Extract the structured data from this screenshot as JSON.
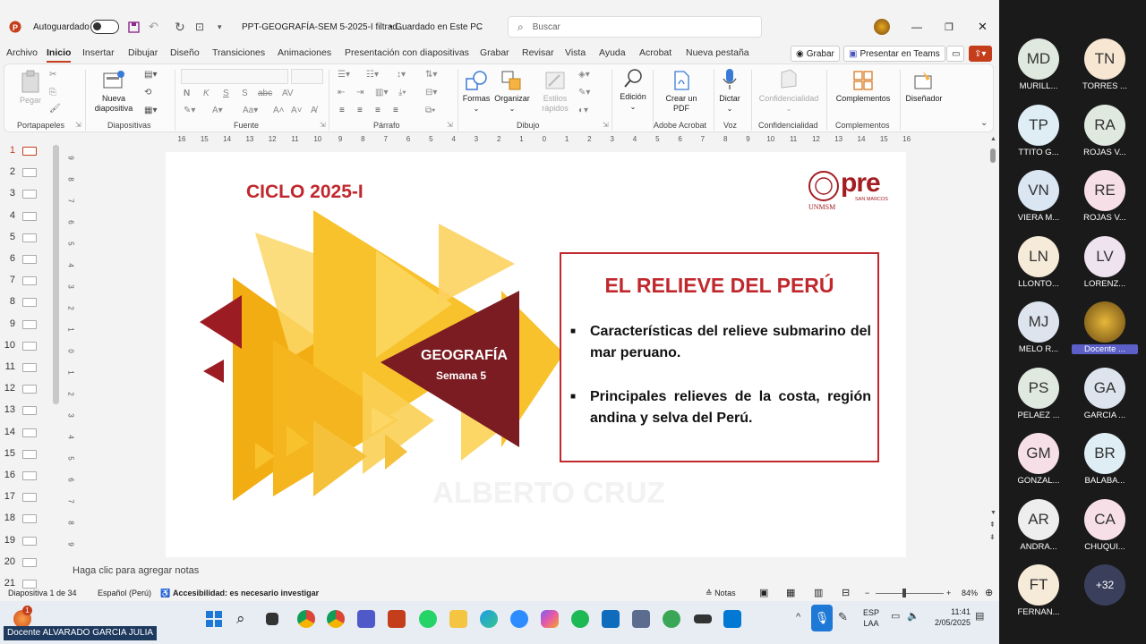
{
  "titlebar": {
    "autosave_label": "Autoguardado",
    "doc_title": "PPT-GEOGRAFÍA-SEM 5-2025-I filtrad...",
    "save_status": "• Guardado en Este PC",
    "search_placeholder": "Buscar"
  },
  "menu": {
    "tabs": [
      "Archivo",
      "Inicio",
      "Insertar",
      "Dibujar",
      "Diseño",
      "Transiciones",
      "Animaciones",
      "Presentación con diapositivas",
      "Grabar",
      "Revisar",
      "Vista",
      "Ayuda",
      "Acrobat",
      "Nueva pestaña"
    ],
    "grabar_btn": "Grabar",
    "teams_btn": "Presentar en Teams"
  },
  "ribbon": {
    "groups": [
      "Portapapeles",
      "Diapositivas",
      "Fuente",
      "Párrafo",
      "Dibujo",
      "Adobe Acrobat",
      "Voz",
      "Confidencialidad",
      "Complementos"
    ],
    "pegar": "Pegar",
    "nueva_diapositiva": "Nueva diapositiva",
    "formas": "Formas",
    "organizar": "Organizar",
    "estilos_rapidos": "Estilos rápidos",
    "edicion": "Edición",
    "crear_pdf": "Crear un PDF",
    "dictar": "Dictar",
    "confidencialidad_btn": "Confidencialidad",
    "complementos_btn": "Complementos",
    "disenador": "Diseñador"
  },
  "ruler": {
    "h": [
      "16",
      "15",
      "14",
      "13",
      "12",
      "11",
      "10",
      "9",
      "8",
      "7",
      "6",
      "5",
      "4",
      "3",
      "2",
      "1",
      "0",
      "1",
      "2",
      "3",
      "4",
      "5",
      "6",
      "7",
      "8",
      "9",
      "10",
      "11",
      "12",
      "13",
      "14",
      "15",
      "16"
    ],
    "v": [
      "9",
      "8",
      "7",
      "6",
      "5",
      "4",
      "3",
      "2",
      "1",
      "0",
      "1",
      "2",
      "3",
      "4",
      "5",
      "6",
      "7",
      "8",
      "9"
    ]
  },
  "thumbnails": [
    "1",
    "2",
    "3",
    "4",
    "5",
    "6",
    "7",
    "8",
    "9",
    "10",
    "11",
    "12",
    "13",
    "14",
    "15",
    "16",
    "17",
    "18",
    "19",
    "20",
    "21"
  ],
  "slide": {
    "ciclo": "CICLO 2025-I",
    "logo_text": "pre",
    "logo_sub": "SAN MARCOS",
    "logo_org": "UNMSM",
    "subject": "GEOGRAFÍA",
    "week": "Semana 5",
    "heading": "EL RELIEVE DEL PERÚ",
    "bullets": [
      "Características del relieve submarino del mar peruano.",
      "Principales relieves de la costa, región andina y selva del Perú."
    ],
    "watermark": "ALBERTO CRUZ"
  },
  "notes_placeholder": "Haga clic para agregar notas",
  "status": {
    "slide_info": "Diapositiva 1 de 34",
    "language": "Español (Perú)",
    "accessibility": "Accesibilidad: es necesario investigar",
    "notes_btn": "Notas",
    "zoom": "84%"
  },
  "taskbar": {
    "lang": "ESP",
    "lang2": "LAA",
    "time": "11:41",
    "date": "2/05/2025",
    "notif_badge": "1"
  },
  "presenter_label": "Docente ALVARADO GARCIA JULIA",
  "participants": [
    {
      "initials": "MD",
      "name": "MURILL...",
      "color": "#dfe9df"
    },
    {
      "initials": "TN",
      "name": "TORRES ...",
      "color": "#f6e6d2"
    },
    {
      "initials": "TP",
      "name": "TTITO G...",
      "color": "#dfeef5"
    },
    {
      "initials": "RA",
      "name": "ROJAS V...",
      "color": "#dfe9df"
    },
    {
      "initials": "VN",
      "name": "VIERA M...",
      "color": "#dbe6f3"
    },
    {
      "initials": "RE",
      "name": "ROJAS V...",
      "color": "#f6dfe6"
    },
    {
      "initials": "LN",
      "name": "LLONTO...",
      "color": "#f6ead8"
    },
    {
      "initials": "LV",
      "name": "LORENZ...",
      "color": "#efe3ef"
    },
    {
      "initials": "MJ",
      "name": "MELO R...",
      "color": "#dde4ee"
    },
    {
      "initials": "",
      "name": "Docente ...",
      "color": "#8a6a1f"
    },
    {
      "initials": "PS",
      "name": "PELAEZ ...",
      "color": "#dfe9df"
    },
    {
      "initials": "GA",
      "name": "GARCIA ...",
      "color": "#dde4ee"
    },
    {
      "initials": "GM",
      "name": "GONZAL...",
      "color": "#f6dfe6"
    },
    {
      "initials": "BR",
      "name": "BALABA...",
      "color": "#dfeef5"
    },
    {
      "initials": "AR",
      "name": "ANDRA...",
      "color": "#eeeeee"
    },
    {
      "initials": "CA",
      "name": "CHUQUI...",
      "color": "#f6dfe6"
    },
    {
      "initials": "FT",
      "name": "FERNAN...",
      "color": "#f6ead8"
    },
    {
      "initials": "+32",
      "name": "",
      "color": "#3a3f5c"
    }
  ],
  "colors": {
    "accent": "#c43e1c",
    "slide_red": "#c0282d",
    "maroon": "#7b1c22",
    "yellow": "#f7b500"
  }
}
